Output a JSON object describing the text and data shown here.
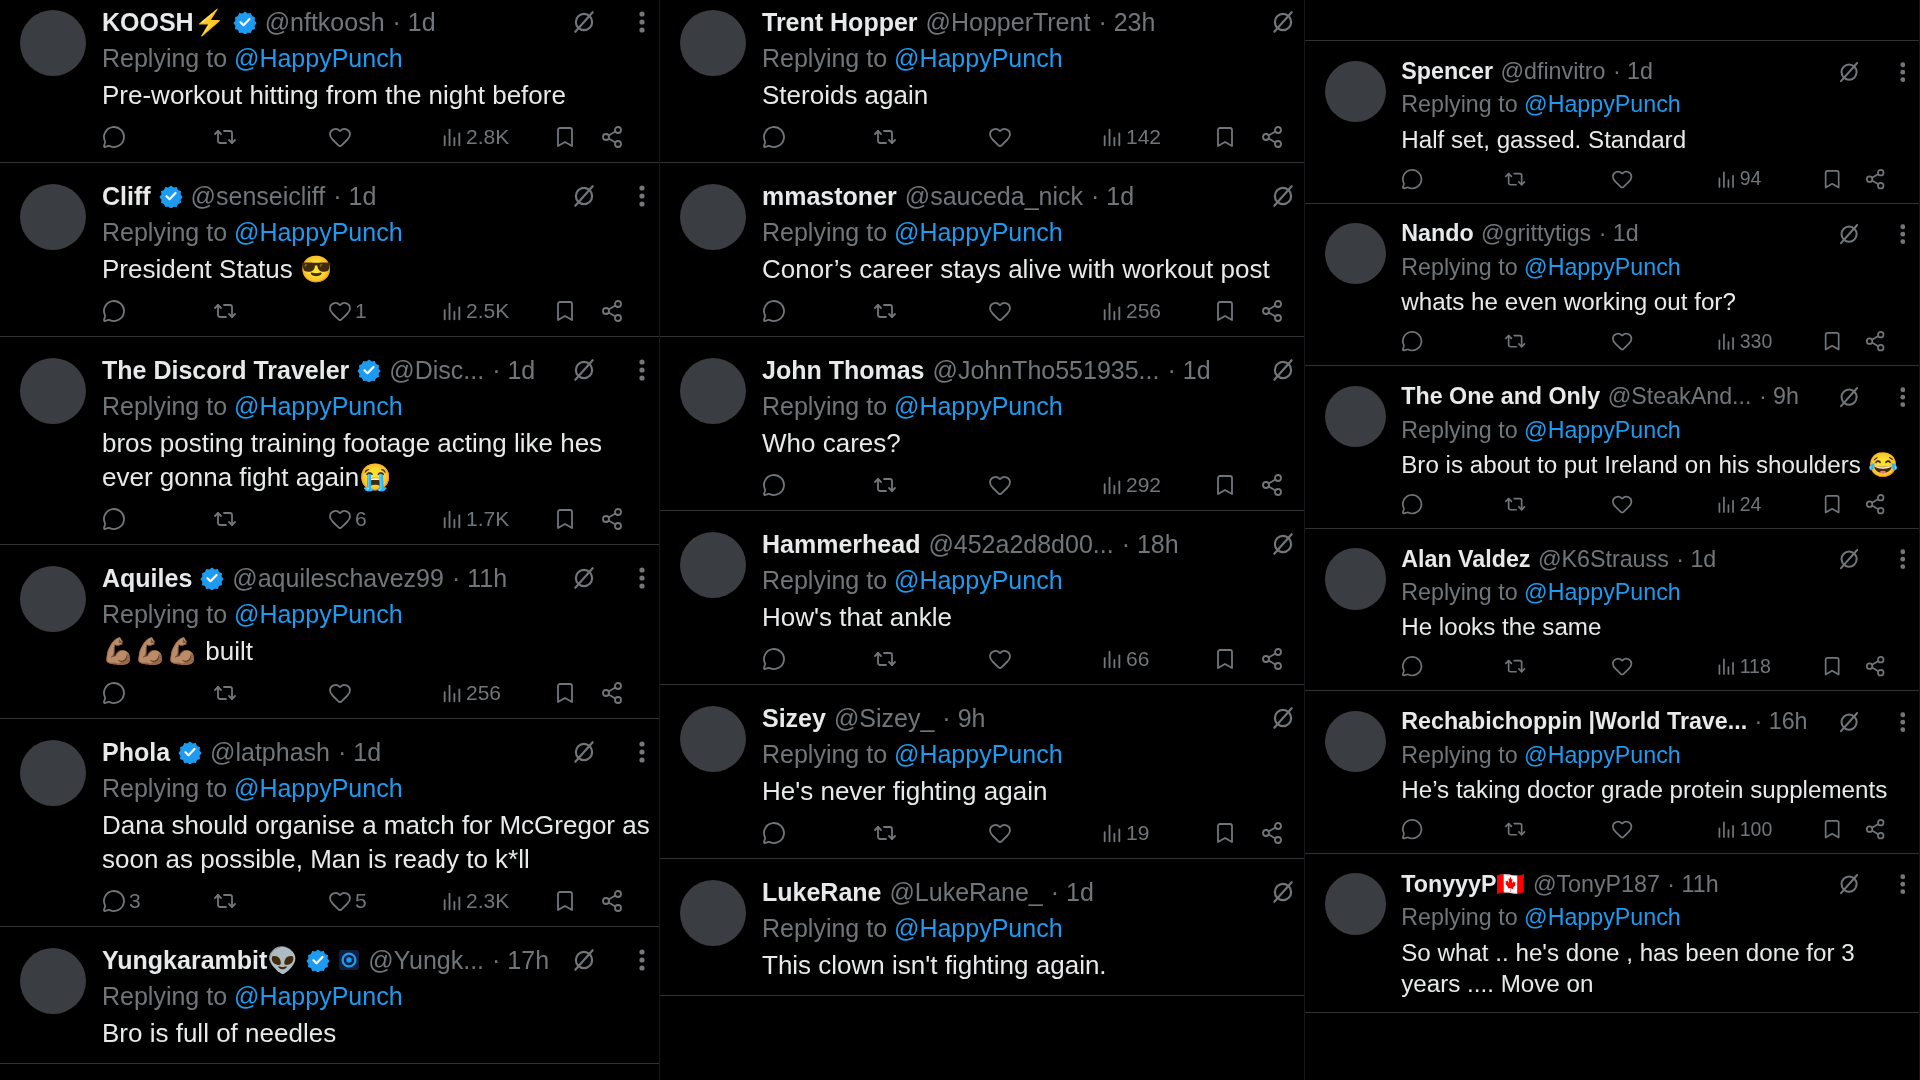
{
  "columns": [
    {
      "show_more": true,
      "tweets": [
        {
          "name": "KOOSH⚡",
          "verified": true,
          "affiliate": false,
          "handle": "@nftkoosh",
          "time": "· 1d",
          "replying": "Replying to",
          "mention": "@HappyPunch",
          "text": "Pre-workout hitting from the night before",
          "actions": {
            "views": "2.8K"
          }
        },
        {
          "name": "Cliff",
          "verified": true,
          "affiliate": false,
          "handle": "@senseicliff",
          "time": "· 1d",
          "replying": "Replying to",
          "mention": "@HappyPunch",
          "text": "President Status 😎",
          "actions": {
            "likes": "1",
            "views": "2.5K"
          }
        },
        {
          "name": "The Discord Traveler",
          "verified": true,
          "affiliate": false,
          "handle": "@Disc...",
          "time": "· 1d",
          "replying": "Replying to",
          "mention": "@HappyPunch",
          "text": "bros posting training footage acting like hes ever gonna fight again😭",
          "actions": {
            "likes": "6",
            "views": "1.7K"
          }
        },
        {
          "name": "Aquiles",
          "verified": true,
          "affiliate": false,
          "handle": "@aquileschavez99",
          "time": "· 11h",
          "replying": "Replying to",
          "mention": "@HappyPunch",
          "text": "💪🏽💪🏽💪🏽 built",
          "actions": {
            "views": "256"
          }
        },
        {
          "name": "Phola",
          "verified": true,
          "affiliate": false,
          "handle": "@latphash",
          "time": "· 1d",
          "replying": "Replying to",
          "mention": "@HappyPunch",
          "text": "Dana should organise a match for McGregor as soon as possible, Man is ready to k*ll",
          "actions": {
            "replies": "3",
            "likes": "5",
            "views": "2.3K"
          }
        },
        {
          "name": "Yungkarambit👽",
          "verified": true,
          "affiliate": true,
          "handle": "@Yungk...",
          "time": "· 17h",
          "replying": "Replying to",
          "mention": "@HappyPunch",
          "text": "Bro is full of needles"
        }
      ]
    },
    {
      "show_more": false,
      "tweets": [
        {
          "name": "Trent Hopper",
          "verified": false,
          "affiliate": false,
          "handle": "@HopperTrent",
          "time": "· 23h",
          "replying": "Replying to",
          "mention": "@HappyPunch",
          "text": "Steroids again",
          "actions": {
            "views": "142"
          }
        },
        {
          "name": "mmastoner",
          "verified": false,
          "affiliate": false,
          "handle": "@sauceda_nick",
          "time": "· 1d",
          "replying": "Replying to",
          "mention": "@HappyPunch",
          "text": "Conor’s career stays alive with workout post",
          "actions": {
            "views": "256"
          }
        },
        {
          "name": "John Thomas",
          "verified": false,
          "affiliate": false,
          "handle": "@JohnTho551935...",
          "time": "· 1d",
          "replying": "Replying to",
          "mention": "@HappyPunch",
          "text": "Who cares?",
          "actions": {
            "views": "292"
          }
        },
        {
          "name": "Hammerhead",
          "verified": false,
          "affiliate": false,
          "handle": "@452a2d8d00...",
          "time": "· 18h",
          "replying": "Replying to",
          "mention": "@HappyPunch",
          "text": "How's that ankle",
          "actions": {
            "views": "66"
          }
        },
        {
          "name": "Sizey",
          "verified": false,
          "affiliate": false,
          "handle": "@Sizey_",
          "time": "· 9h",
          "replying": "Replying to",
          "mention": "@HappyPunch",
          "text": "He's never fighting again",
          "actions": {
            "views": "19"
          }
        },
        {
          "name": "LukeRane",
          "verified": false,
          "affiliate": false,
          "handle": "@LukeRane_",
          "time": "· 1d",
          "replying": "Replying to",
          "mention": "@HappyPunch",
          "text": "This clown isn't fighting again."
        }
      ]
    },
    {
      "show_more": true,
      "tweets": [
        {
          "name": "Spencer",
          "verified": false,
          "affiliate": false,
          "handle": "@dfinvitro",
          "time": "· 1d",
          "replying": "Replying to",
          "mention": "@HappyPunch",
          "text": "Half set, gassed.  Standard",
          "actions": {
            "views": "94"
          }
        },
        {
          "name": "Nando",
          "verified": false,
          "affiliate": false,
          "handle": "@grittytigs",
          "time": "· 1d",
          "replying": "Replying to",
          "mention": "@HappyPunch",
          "text": "whats he even working out for?",
          "actions": {
            "views": "330"
          }
        },
        {
          "name": "The One and Only",
          "verified": false,
          "affiliate": false,
          "handle": "@SteakAnd...",
          "time": "· 9h",
          "replying": "Replying to",
          "mention": "@HappyPunch",
          "text": "Bro is about to put Ireland on his shoulders 😂",
          "actions": {
            "views": "24"
          }
        },
        {
          "name": "Alan Valdez",
          "verified": false,
          "affiliate": false,
          "handle": "@K6Strauss",
          "time": "· 1d",
          "replying": "Replying to",
          "mention": "@HappyPunch",
          "text": "He looks the same",
          "actions": {
            "views": "118"
          }
        },
        {
          "name": "Rechabichoppin |World Trave...",
          "verified": false,
          "affiliate": false,
          "time": "· 16h",
          "replying": "Replying to",
          "mention": "@HappyPunch",
          "text": "He’s taking doctor grade protein supplements",
          "actions": {
            "views": "100"
          }
        },
        {
          "name": "TonyyyP🇨🇦",
          "verified": false,
          "affiliate": false,
          "handle": "@TonyP187",
          "time": "· 11h",
          "replying": "Replying to",
          "mention": "@HappyPunch",
          "text": "So what .. he's done , has been done for 3 years .... Move on"
        }
      ]
    }
  ]
}
